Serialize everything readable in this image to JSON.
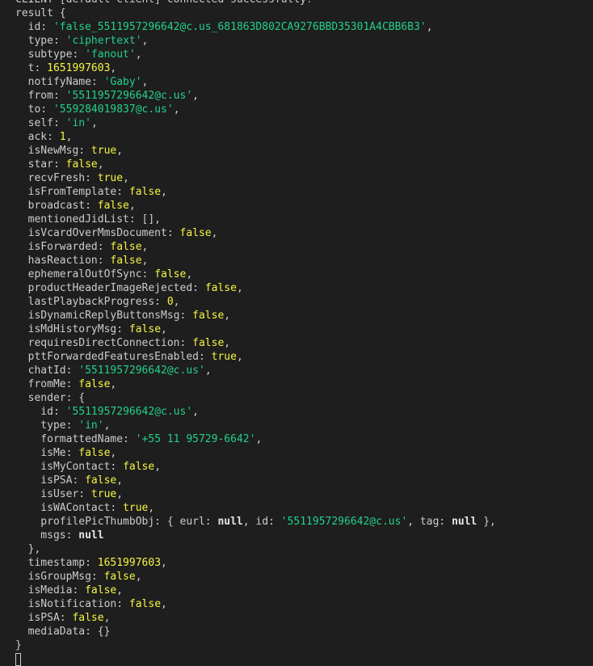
{
  "theme": {
    "background": "#1e1e1e",
    "default_text": "#cccccc",
    "string_color": "#23d18b",
    "number_color": "#f5f543",
    "boolean_color": "#f5f543",
    "null_color": "#e5e5e5"
  },
  "terminal": {
    "lines": [
      [
        {
          "t": "CLIENT [default-client] connected successfully!",
          "c": "pun"
        }
      ],
      [
        {
          "t": "result {",
          "c": "pun"
        }
      ],
      [
        {
          "t": "  id: ",
          "c": "pun"
        },
        {
          "t": "'false_5511957296642@c.us_681863D802CA9276BBD35301A4CBB6B3'",
          "c": "str"
        },
        {
          "t": ",",
          "c": "pun"
        }
      ],
      [
        {
          "t": "  type: ",
          "c": "pun"
        },
        {
          "t": "'ciphertext'",
          "c": "str"
        },
        {
          "t": ",",
          "c": "pun"
        }
      ],
      [
        {
          "t": "  subtype: ",
          "c": "pun"
        },
        {
          "t": "'fanout'",
          "c": "str"
        },
        {
          "t": ",",
          "c": "pun"
        }
      ],
      [
        {
          "t": "  t: ",
          "c": "pun"
        },
        {
          "t": "1651997603",
          "c": "num"
        },
        {
          "t": ",",
          "c": "pun"
        }
      ],
      [
        {
          "t": "  notifyName: ",
          "c": "pun"
        },
        {
          "t": "'Gaby'",
          "c": "str"
        },
        {
          "t": ",",
          "c": "pun"
        }
      ],
      [
        {
          "t": "  from: ",
          "c": "pun"
        },
        {
          "t": "'5511957296642@c.us'",
          "c": "str"
        },
        {
          "t": ",",
          "c": "pun"
        }
      ],
      [
        {
          "t": "  to: ",
          "c": "pun"
        },
        {
          "t": "'559284019837@c.us'",
          "c": "str"
        },
        {
          "t": ",",
          "c": "pun"
        }
      ],
      [
        {
          "t": "  self: ",
          "c": "pun"
        },
        {
          "t": "'in'",
          "c": "str"
        },
        {
          "t": ",",
          "c": "pun"
        }
      ],
      [
        {
          "t": "  ack: ",
          "c": "pun"
        },
        {
          "t": "1",
          "c": "num"
        },
        {
          "t": ",",
          "c": "pun"
        }
      ],
      [
        {
          "t": "  isNewMsg: ",
          "c": "pun"
        },
        {
          "t": "true",
          "c": "bool"
        },
        {
          "t": ",",
          "c": "pun"
        }
      ],
      [
        {
          "t": "  star: ",
          "c": "pun"
        },
        {
          "t": "false",
          "c": "bool"
        },
        {
          "t": ",",
          "c": "pun"
        }
      ],
      [
        {
          "t": "  recvFresh: ",
          "c": "pun"
        },
        {
          "t": "true",
          "c": "bool"
        },
        {
          "t": ",",
          "c": "pun"
        }
      ],
      [
        {
          "t": "  isFromTemplate: ",
          "c": "pun"
        },
        {
          "t": "false",
          "c": "bool"
        },
        {
          "t": ",",
          "c": "pun"
        }
      ],
      [
        {
          "t": "  broadcast: ",
          "c": "pun"
        },
        {
          "t": "false",
          "c": "bool"
        },
        {
          "t": ",",
          "c": "pun"
        }
      ],
      [
        {
          "t": "  mentionedJidList: [],",
          "c": "pun"
        }
      ],
      [
        {
          "t": "  isVcardOverMmsDocument: ",
          "c": "pun"
        },
        {
          "t": "false",
          "c": "bool"
        },
        {
          "t": ",",
          "c": "pun"
        }
      ],
      [
        {
          "t": "  isForwarded: ",
          "c": "pun"
        },
        {
          "t": "false",
          "c": "bool"
        },
        {
          "t": ",",
          "c": "pun"
        }
      ],
      [
        {
          "t": "  hasReaction: ",
          "c": "pun"
        },
        {
          "t": "false",
          "c": "bool"
        },
        {
          "t": ",",
          "c": "pun"
        }
      ],
      [
        {
          "t": "  ephemeralOutOfSync: ",
          "c": "pun"
        },
        {
          "t": "false",
          "c": "bool"
        },
        {
          "t": ",",
          "c": "pun"
        }
      ],
      [
        {
          "t": "  productHeaderImageRejected: ",
          "c": "pun"
        },
        {
          "t": "false",
          "c": "bool"
        },
        {
          "t": ",",
          "c": "pun"
        }
      ],
      [
        {
          "t": "  lastPlaybackProgress: ",
          "c": "pun"
        },
        {
          "t": "0",
          "c": "num"
        },
        {
          "t": ",",
          "c": "pun"
        }
      ],
      [
        {
          "t": "  isDynamicReplyButtonsMsg: ",
          "c": "pun"
        },
        {
          "t": "false",
          "c": "bool"
        },
        {
          "t": ",",
          "c": "pun"
        }
      ],
      [
        {
          "t": "  isMdHistoryMsg: ",
          "c": "pun"
        },
        {
          "t": "false",
          "c": "bool"
        },
        {
          "t": ",",
          "c": "pun"
        }
      ],
      [
        {
          "t": "  requiresDirectConnection: ",
          "c": "pun"
        },
        {
          "t": "false",
          "c": "bool"
        },
        {
          "t": ",",
          "c": "pun"
        }
      ],
      [
        {
          "t": "  pttForwardedFeaturesEnabled: ",
          "c": "pun"
        },
        {
          "t": "true",
          "c": "bool"
        },
        {
          "t": ",",
          "c": "pun"
        }
      ],
      [
        {
          "t": "  chatId: ",
          "c": "pun"
        },
        {
          "t": "'5511957296642@c.us'",
          "c": "str"
        },
        {
          "t": ",",
          "c": "pun"
        }
      ],
      [
        {
          "t": "  fromMe: ",
          "c": "pun"
        },
        {
          "t": "false",
          "c": "bool"
        },
        {
          "t": ",",
          "c": "pun"
        }
      ],
      [
        {
          "t": "  sender: {",
          "c": "pun"
        }
      ],
      [
        {
          "t": "    id: ",
          "c": "pun"
        },
        {
          "t": "'5511957296642@c.us'",
          "c": "str"
        },
        {
          "t": ",",
          "c": "pun"
        }
      ],
      [
        {
          "t": "    type: ",
          "c": "pun"
        },
        {
          "t": "'in'",
          "c": "str"
        },
        {
          "t": ",",
          "c": "pun"
        }
      ],
      [
        {
          "t": "    formattedName: ",
          "c": "pun"
        },
        {
          "t": "'+55 11 95729-6642'",
          "c": "str"
        },
        {
          "t": ",",
          "c": "pun"
        }
      ],
      [
        {
          "t": "    isMe: ",
          "c": "pun"
        },
        {
          "t": "false",
          "c": "bool"
        },
        {
          "t": ",",
          "c": "pun"
        }
      ],
      [
        {
          "t": "    isMyContact: ",
          "c": "pun"
        },
        {
          "t": "false",
          "c": "bool"
        },
        {
          "t": ",",
          "c": "pun"
        }
      ],
      [
        {
          "t": "    isPSA: ",
          "c": "pun"
        },
        {
          "t": "false",
          "c": "bool"
        },
        {
          "t": ",",
          "c": "pun"
        }
      ],
      [
        {
          "t": "    isUser: ",
          "c": "pun"
        },
        {
          "t": "true",
          "c": "bool"
        },
        {
          "t": ",",
          "c": "pun"
        }
      ],
      [
        {
          "t": "    isWAContact: ",
          "c": "pun"
        },
        {
          "t": "true",
          "c": "bool"
        },
        {
          "t": ",",
          "c": "pun"
        }
      ],
      [
        {
          "t": "    profilePicThumbObj: { eurl: ",
          "c": "pun"
        },
        {
          "t": "null",
          "c": "nul"
        },
        {
          "t": ", id: ",
          "c": "pun"
        },
        {
          "t": "'5511957296642@c.us'",
          "c": "str"
        },
        {
          "t": ", tag: ",
          "c": "pun"
        },
        {
          "t": "null",
          "c": "nul"
        },
        {
          "t": " },",
          "c": "pun"
        }
      ],
      [
        {
          "t": "    msgs: ",
          "c": "pun"
        },
        {
          "t": "null",
          "c": "nul"
        }
      ],
      [
        {
          "t": "  },",
          "c": "pun"
        }
      ],
      [
        {
          "t": "  timestamp: ",
          "c": "pun"
        },
        {
          "t": "1651997603",
          "c": "num"
        },
        {
          "t": ",",
          "c": "pun"
        }
      ],
      [
        {
          "t": "  isGroupMsg: ",
          "c": "pun"
        },
        {
          "t": "false",
          "c": "bool"
        },
        {
          "t": ",",
          "c": "pun"
        }
      ],
      [
        {
          "t": "  isMedia: ",
          "c": "pun"
        },
        {
          "t": "false",
          "c": "bool"
        },
        {
          "t": ",",
          "c": "pun"
        }
      ],
      [
        {
          "t": "  isNotification: ",
          "c": "pun"
        },
        {
          "t": "false",
          "c": "bool"
        },
        {
          "t": ",",
          "c": "pun"
        }
      ],
      [
        {
          "t": "  isPSA: ",
          "c": "pun"
        },
        {
          "t": "false",
          "c": "bool"
        },
        {
          "t": ",",
          "c": "pun"
        }
      ],
      [
        {
          "t": "  mediaData: {}",
          "c": "pun"
        }
      ],
      [
        {
          "t": "}",
          "c": "pun"
        }
      ]
    ]
  }
}
